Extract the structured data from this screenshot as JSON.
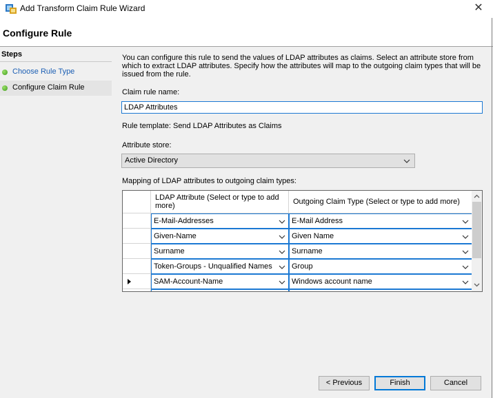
{
  "window": {
    "title": "Add Transform Claim Rule Wizard",
    "close_glyph": "✕",
    "page_title": "Configure Rule"
  },
  "steps": {
    "header": "Steps",
    "items": [
      {
        "label": "Choose Rule Type",
        "state": "link"
      },
      {
        "label": "Configure Claim Rule",
        "state": "current"
      }
    ]
  },
  "content": {
    "intro": "You can configure this rule to send the values of LDAP attributes as claims. Select an attribute store from which to extract LDAP attributes. Specify how the attributes will map to the outgoing claim types that will be issued from the rule.",
    "claim_rule_name_label": "Claim rule name:",
    "claim_rule_name_value": "LDAP Attributes",
    "rule_template": "Rule template: Send LDAP Attributes as Claims",
    "attribute_store_label": "Attribute store:",
    "attribute_store_value": "Active Directory",
    "mapping_label": "Mapping of LDAP attributes to outgoing claim types:"
  },
  "grid": {
    "col_ldap": "LDAP Attribute (Select or type to add more)",
    "col_claim": "Outgoing Claim Type (Select or type to add more)",
    "rows": [
      {
        "ldap": "E-Mail-Addresses",
        "claim": "E-Mail Address",
        "selected": false
      },
      {
        "ldap": "Given-Name",
        "claim": "Given Name",
        "selected": false
      },
      {
        "ldap": "Surname",
        "claim": "Surname",
        "selected": false
      },
      {
        "ldap": "Token-Groups - Unqualified Names",
        "claim": "Group",
        "selected": false
      },
      {
        "ldap": "SAM-Account-Name",
        "claim": "Windows account name",
        "selected": true
      }
    ]
  },
  "buttons": {
    "previous": "< Previous",
    "finish": "Finish",
    "cancel": "Cancel"
  },
  "colors": {
    "accent": "#1a78d3",
    "link": "#1c5fb4",
    "step_ok": "#3f9c1b",
    "panel": "#f0f0f0"
  },
  "icons": {
    "app": "claim-wizard-icon",
    "close": "close-icon",
    "dropdown": "chevron-down-icon",
    "step": "green-check-dot-icon",
    "row_pointer": "row-pointer-icon"
  }
}
